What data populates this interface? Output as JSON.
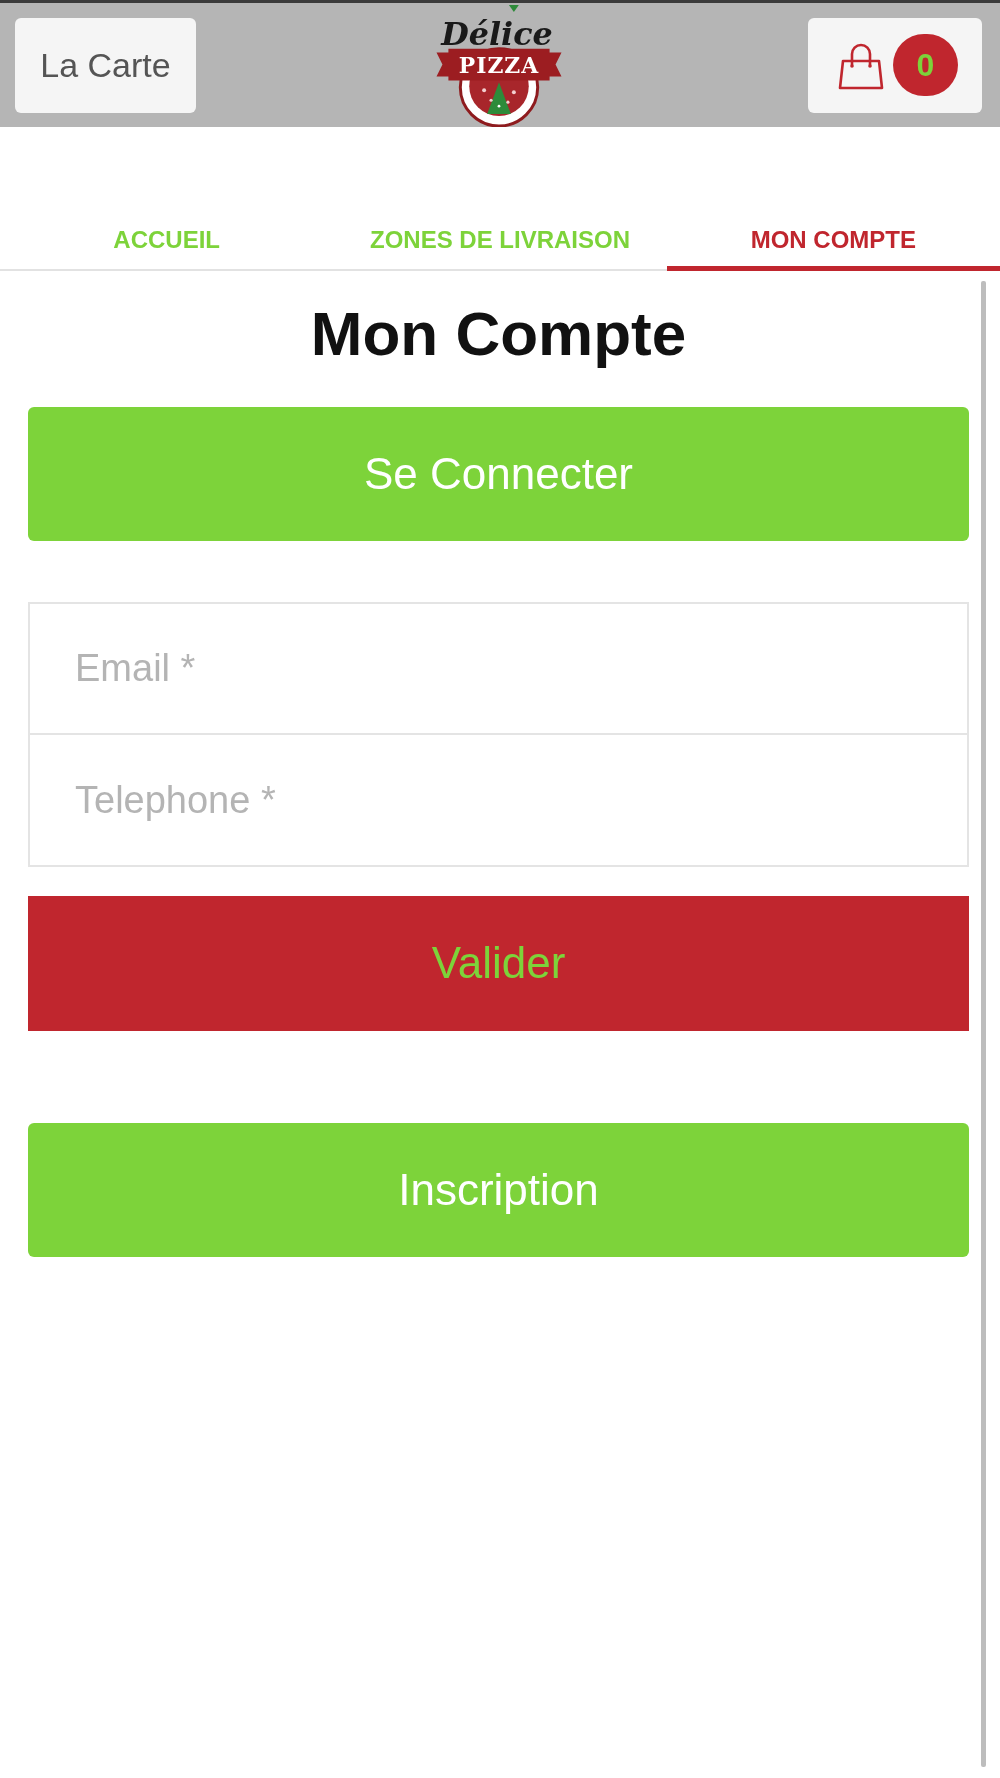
{
  "header": {
    "menu_button": {
      "label": "La Carte"
    },
    "logo": {
      "script": "Délice",
      "banner": "PIZZA"
    },
    "cart": {
      "count": "0"
    }
  },
  "tabs": [
    {
      "label": "ACCUEIL",
      "selected": false
    },
    {
      "label": "ZONES DE LIVRAISON",
      "selected": false
    },
    {
      "label": "MON COMPTE",
      "selected": true
    }
  ],
  "page": {
    "title": "Mon Compte",
    "login_button": {
      "label": "Se Connecter"
    },
    "fields": [
      {
        "placeholder": "Email *"
      },
      {
        "placeholder": "Telephone *"
      }
    ],
    "submit_button": {
      "label": "Valider"
    },
    "signup_button": {
      "label": "Inscription"
    }
  }
}
